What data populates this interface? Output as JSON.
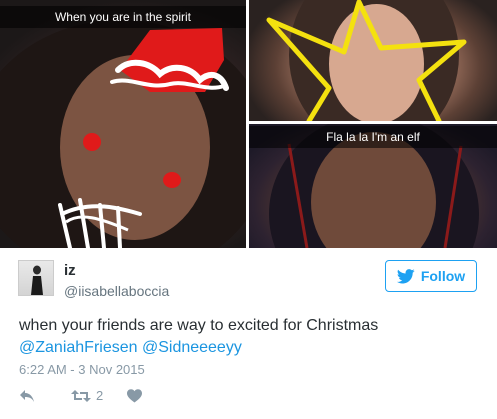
{
  "collage": {
    "left_caption": "When you are in the spirit",
    "bottom_right_caption": "Fla la la I'm an elf"
  },
  "tweet": {
    "user_name": "iz",
    "user_handle": "@iisabellaboccia",
    "follow_label": "Follow",
    "text": "when your friends are way to excited for Christmas",
    "mentions": [
      "@ZaniahFriesen",
      "@Sidneeeeyy"
    ],
    "timestamp": "6:22 AM - 3 Nov 2015",
    "retweet_count": "2"
  },
  "colors": {
    "accent": "#1da1f2",
    "mention": "#1b95e0",
    "muted": "#8899a6"
  },
  "icons": {
    "follow": "twitter-bird-icon",
    "reply": "reply-icon",
    "retweet": "retweet-icon",
    "like": "heart-icon"
  }
}
